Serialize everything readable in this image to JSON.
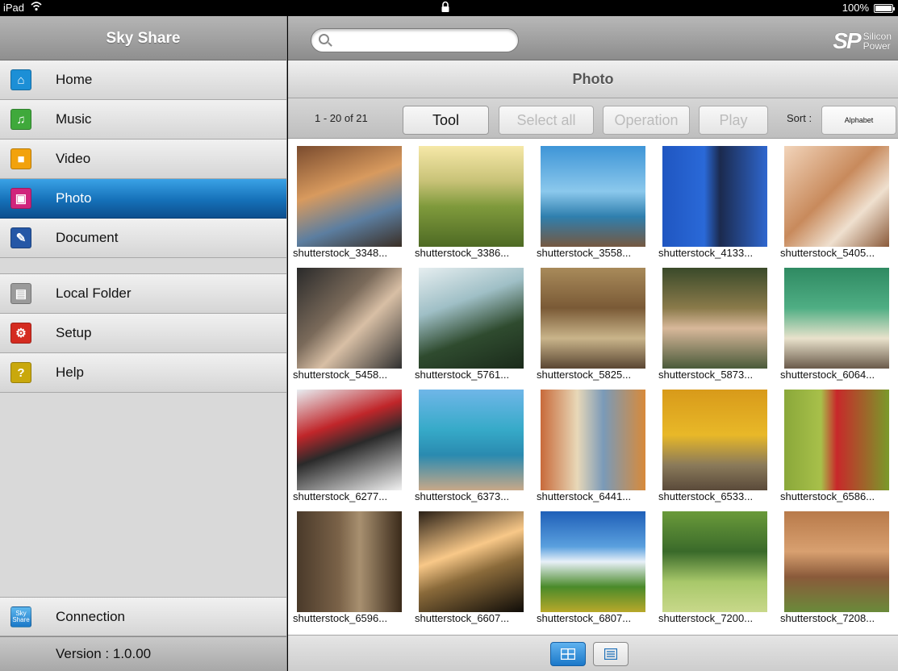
{
  "status_bar": {
    "carrier": "iPad",
    "battery": "100%"
  },
  "sidebar": {
    "title": "Sky Share",
    "items": [
      {
        "label": "Home",
        "icon": "home-icon",
        "color": "#1c8fd6",
        "glyph": "⌂"
      },
      {
        "label": "Music",
        "icon": "headphones-icon",
        "color": "#3fa93b",
        "glyph": "♫"
      },
      {
        "label": "Video",
        "icon": "video-icon",
        "color": "#f2a20c",
        "glyph": "■"
      },
      {
        "label": "Photo",
        "icon": "photo-icon",
        "color": "#d0247c",
        "glyph": "▣",
        "active": true
      },
      {
        "label": "Document",
        "icon": "document-icon",
        "color": "#2557a6",
        "glyph": "✎"
      }
    ],
    "items2": [
      {
        "label": "Local Folder",
        "icon": "clipboard-icon",
        "color": "#9a9a9a",
        "glyph": "▤"
      },
      {
        "label": "Setup",
        "icon": "gears-icon",
        "color": "#d42b20",
        "glyph": "⚙"
      },
      {
        "label": "Help",
        "icon": "help-icon",
        "color": "#c9a80c",
        "glyph": "?"
      }
    ],
    "connection": {
      "label": "Connection",
      "icon": "sky-share-icon",
      "icon_text": "Sky Share"
    },
    "version": "Version : 1.0.00"
  },
  "main": {
    "search": {
      "placeholder": "",
      "value": ""
    },
    "brand": {
      "sp": "SP",
      "line1": "Silicon",
      "line2": "Power"
    },
    "title": "Photo",
    "toolbar": {
      "count": "1 - 20 of 21",
      "tool": "Tool",
      "select_all": "Select all",
      "operation": "Operation",
      "play": "Play",
      "sort_label": "Sort :",
      "sort_value": "Alphabet"
    },
    "photos": [
      {
        "name": "shutterstock_3348...",
        "bg": "linear-gradient(160deg,#7a4b2e,#d89a5e 40%,#5c7ea0 70%,#3a2e25)"
      },
      {
        "name": "shutterstock_3386...",
        "bg": "linear-gradient(180deg,#f6e8a8,#c8c277 35%,#7f9a3c 60%,#4e6a24)"
      },
      {
        "name": "shutterstock_3558...",
        "bg": "linear-gradient(180deg,#3e95d7,#8bc8ec 45%,#2f7fae 70%,#765840)"
      },
      {
        "name": "shutterstock_4133...",
        "bg": "linear-gradient(90deg,#1f56c1,#2a69d8 40%,#1b2a4e 55%,#2f67cf)"
      },
      {
        "name": "shutterstock_5405...",
        "bg": "linear-gradient(135deg,#f2d4ba,#c88a5c 45%,#efe0cf 70%,#8a5a3a)"
      },
      {
        "name": "shutterstock_5458...",
        "bg": "linear-gradient(135deg,#2a2a2a,#7a6a5a 40%,#d8bfa5 60%,#303030)"
      },
      {
        "name": "shutterstock_5761...",
        "bg": "linear-gradient(160deg,#e6eef0,#9fbfc6 35%,#2f4b2f 65%,#1a2a1a)"
      },
      {
        "name": "shutterstock_5825...",
        "bg": "linear-gradient(180deg,#a88a5a,#7a5a36 40%,#c9b48a 70%,#5a4632)"
      },
      {
        "name": "shutterstock_5873...",
        "bg": "linear-gradient(180deg,#3a4a2a,#8a7a4a 40%,#d8b89a 60%,#4a5a3a)"
      },
      {
        "name": "shutterstock_6064...",
        "bg": "linear-gradient(180deg,#2f8a62,#4fae84 40%,#e9e2cc 70%,#6a5a4a)"
      },
      {
        "name": "shutterstock_6277...",
        "bg": "linear-gradient(160deg,#e8eef2,#c0262a 35%,#2a2a2a 55%,#f2f2f2)"
      },
      {
        "name": "shutterstock_6373...",
        "bg": "linear-gradient(180deg,#6fb6e8,#36aac8 40%,#2a8ab0 65%,#c8a888)"
      },
      {
        "name": "shutterstock_6441...",
        "bg": "linear-gradient(90deg,#c86a3a,#e8d8b8 35%,#7a9ab8 60%,#d88a3a)"
      },
      {
        "name": "shutterstock_6533...",
        "bg": "linear-gradient(180deg,#d89a1a,#e8b828 45%,#8a7a5a 75%,#5a4a3a)"
      },
      {
        "name": "shutterstock_6586...",
        "bg": "linear-gradient(90deg,#8aa83a,#a8c04a 35%,#c8282a 50%,#7a9a2a)"
      },
      {
        "name": "shutterstock_6596...",
        "bg": "linear-gradient(90deg,#4a3a2a,#7a6248 40%,#a89070 60%,#3a2a1a)"
      },
      {
        "name": "shutterstock_6607...",
        "bg": "linear-gradient(160deg,#2a2016,#f8c888 40%,#8a6a3a 60%,#0f0c08)"
      },
      {
        "name": "shutterstock_6807...",
        "bg": "linear-gradient(180deg,#1f5fb8,#5aa0de 35%,#e8f0f8 50%,#4a8a2a 75%,#b8a82a)"
      },
      {
        "name": "shutterstock_7200...",
        "bg": "linear-gradient(180deg,#6a9a3a,#3a6a2a 40%,#a8c86a 70%,#c8d88a)"
      },
      {
        "name": "shutterstock_7208...",
        "bg": "linear-gradient(180deg,#b87a4a,#d8a070 40%,#8a5a3a 65%,#6a8a3a)"
      }
    ]
  }
}
